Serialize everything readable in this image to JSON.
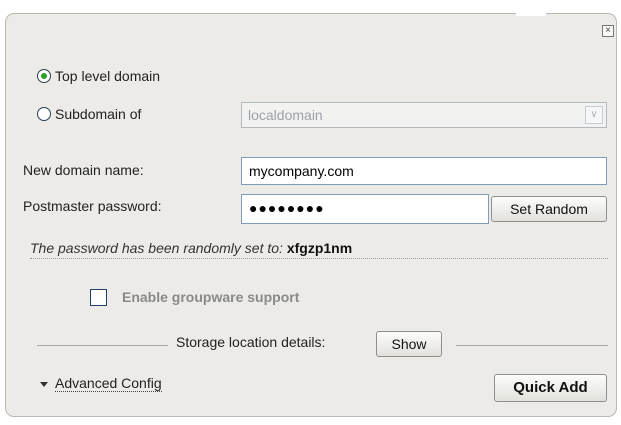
{
  "domain_type": {
    "options": [
      {
        "label": "Top level domain",
        "checked": true
      },
      {
        "label": "Subdomain of",
        "checked": false
      }
    ],
    "subdomain_select": {
      "selected": "localdomain"
    }
  },
  "form": {
    "domain_label": "New domain name:",
    "domain_value": "mycompany.com",
    "password_label": "Postmaster password:",
    "password_value": "●●●●●●●●",
    "set_random_label": "Set Random"
  },
  "notice": {
    "text": "The password has been randomly set to:",
    "password": "xfgzp1nm"
  },
  "groupware": {
    "label": "Enable groupware support",
    "checked": false
  },
  "storage": {
    "label": "Storage location details:",
    "show_label": "Show"
  },
  "footer": {
    "advanced_label": "Advanced Config",
    "quick_add_label": "Quick Add"
  },
  "icons": {
    "close": "close-icon",
    "dropdown": "chevron-down-icon",
    "expander": "triangle-down-icon"
  },
  "colors": {
    "panel_bg": "#ecebe7",
    "radio_checked": "#26a326",
    "input_border": "#7f9db9",
    "checkbox_border": "#20426a"
  }
}
